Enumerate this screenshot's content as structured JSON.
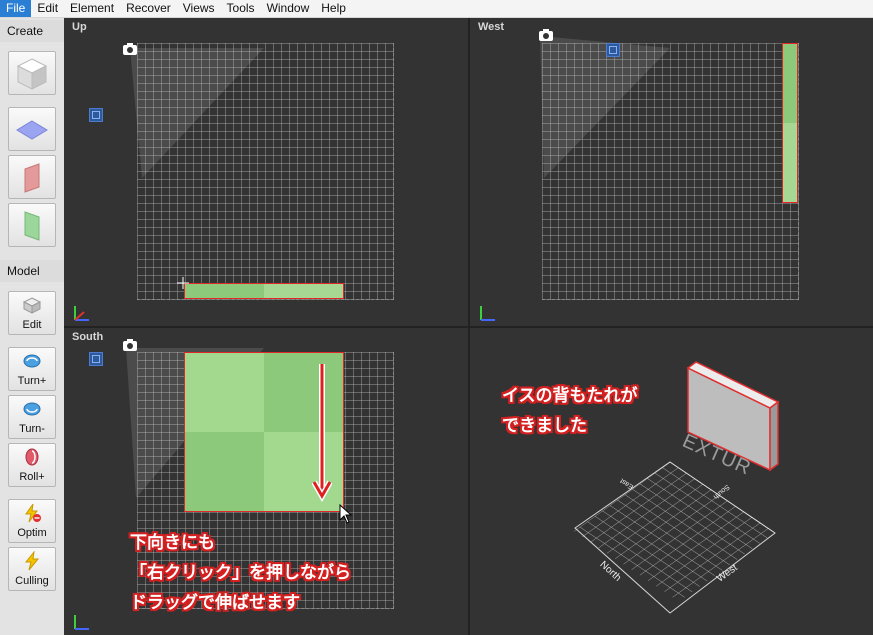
{
  "menu": [
    "File",
    "Edit",
    "Element",
    "Recover",
    "Views",
    "Tools",
    "Window",
    "Help"
  ],
  "sidebar": {
    "create_header": "Create",
    "model_header": "Model",
    "buttons": [
      {
        "label": "Edit"
      },
      {
        "label": "Turn+"
      },
      {
        "label": "Turn-"
      },
      {
        "label": "Roll+"
      },
      {
        "label": "Optim"
      },
      {
        "label": "Culling"
      }
    ]
  },
  "viewports": {
    "up": "Up",
    "west": "West",
    "south": "South"
  },
  "annotations": {
    "south_line1": "下向きにも",
    "south_line2": "「右クリック」を押しながら",
    "south_line3": "ドラッグで伸ばせます",
    "persp_line1": "イスの背もたれが",
    "persp_line2": "できました"
  },
  "perspective": {
    "block_text": "EXTUR",
    "axis_north": "North",
    "axis_west": "West",
    "axis_east": "East",
    "axis_south": "South"
  },
  "colors": {
    "menu_active": "#2a7fd4",
    "panel_green": "#8cc97a",
    "selection_red": "#e02828"
  }
}
